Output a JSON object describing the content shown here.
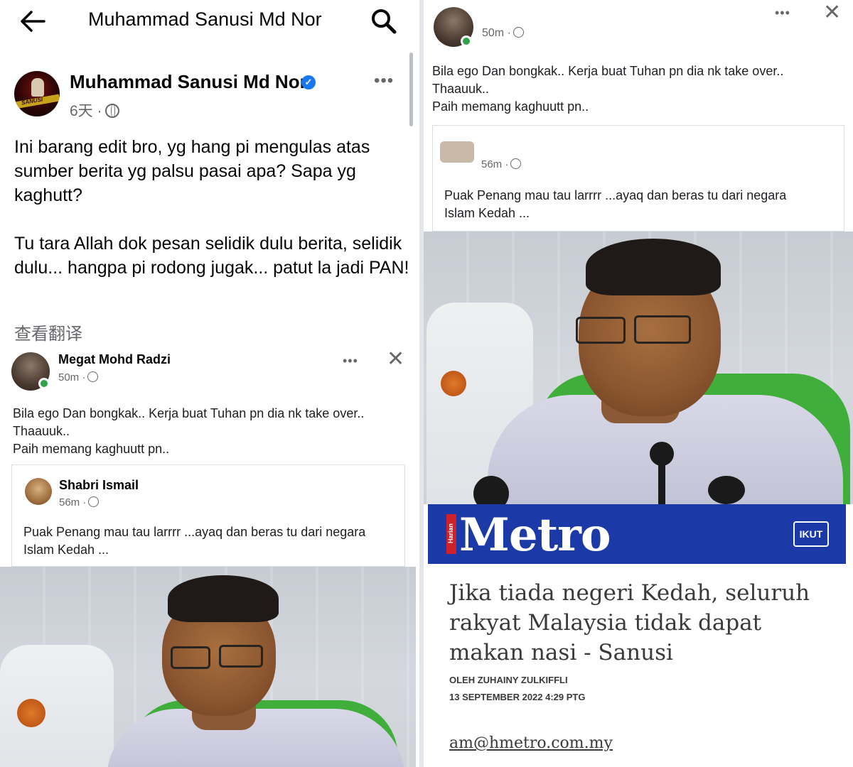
{
  "appbar": {
    "title": "Muhammad Sanusi Md Nor"
  },
  "post": {
    "author": "Muhammad Sanusi Md Nor",
    "time": "6天 ·",
    "text": "Ini barang edit bro, yg hang pi mengulas atas sumber berita yg palsu pasai apa? Sapa yg kaghutt?\n\nTu tara Allah dok pesan selidik dulu berita, selidik dulu... hangpa pi rodong jugak... patut la jadi PAN!",
    "translate": "查看翻译",
    "avatar_text": "SANUSI"
  },
  "embedded_left": {
    "name": "Megat Mohd Radzi",
    "time": "50m ·",
    "text": "Bila ego Dan bongkak.. Kerja buat Tuhan pn dia nk take over..\nThaauuk..\nPaih memang kaghuutt pn..",
    "shared": {
      "name": "Shabri Ismail",
      "time": "56m ·",
      "text": "Puak Penang mau tau larrrr ...ayaq dan beras tu dari negara\nIslam Kedah ..."
    }
  },
  "embedded_right": {
    "time": "50m ·",
    "text": "Bila ego Dan bongkak.. Kerja buat Tuhan pn dia nk take over..\nThaauuk..\nPaih memang kaghuutt pn..",
    "shared": {
      "time": "56m ·",
      "text": "Puak Penang mau tau larrrr ...ayaq dan beras tu dari negara\nIslam Kedah ..."
    }
  },
  "article": {
    "brand_small": "Harian",
    "brand": "Metro",
    "follow": "IKUT",
    "headline": "Jika tiada negeri Kedah, seluruh rakyat Malaysia tidak dapat makan nasi - Sanusi",
    "byline": "OLEH ZUHAINY ZULKIFFLI",
    "date": "13 SEPTEMBER 2022 4:29 PTG",
    "email": "am@hmetro.com.my"
  },
  "colors": {
    "brand_blue": "#1b3aa8",
    "verified_blue": "#1877f2",
    "online_green": "#31a24c",
    "muted_text": "#65676b"
  },
  "icons": [
    "back-arrow-icon",
    "search-icon",
    "verified-badge-icon",
    "globe-icon",
    "more-options-icon",
    "close-icon"
  ]
}
